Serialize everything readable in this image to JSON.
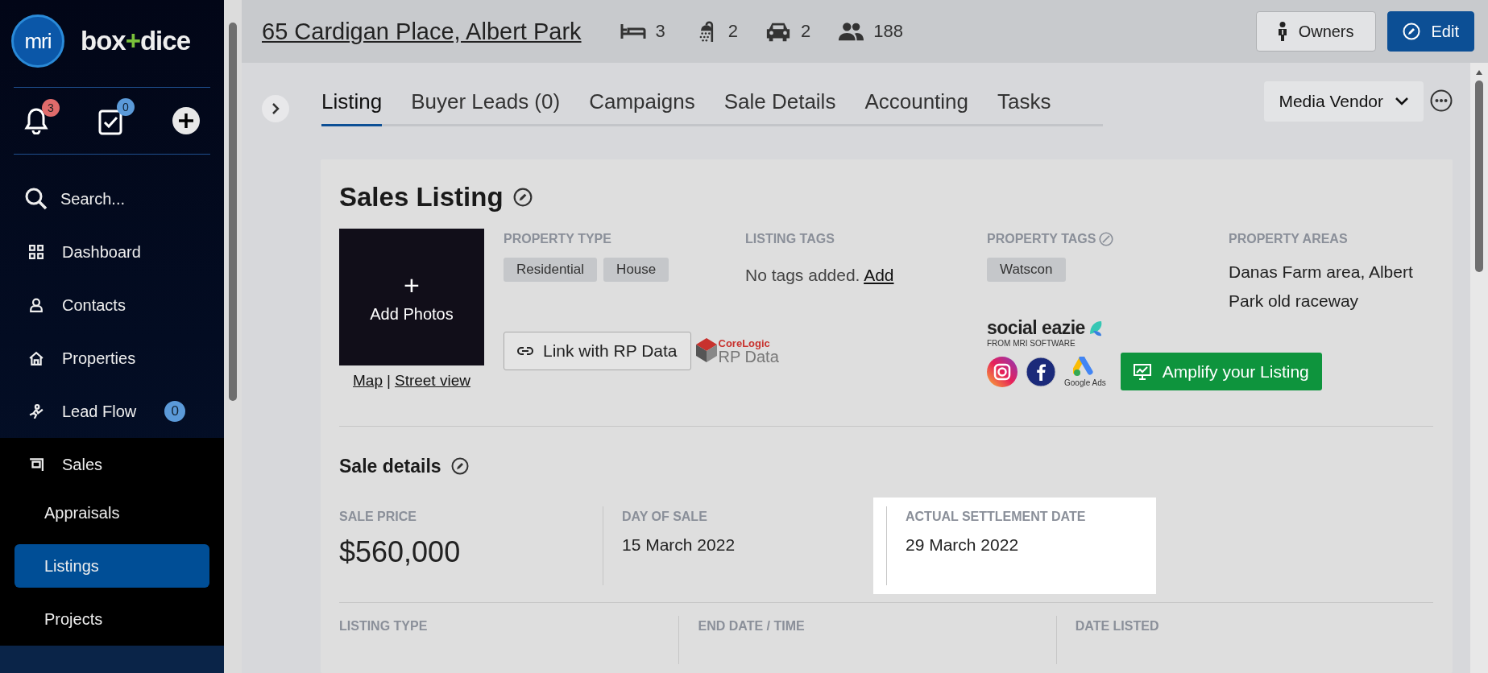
{
  "sidebar": {
    "logo": "mri",
    "brand": {
      "left": "box",
      "joiner": "+",
      "right": "dice"
    },
    "notifications": {
      "badge": "3"
    },
    "tasks": {
      "badge": "0"
    },
    "nav": [
      {
        "label": "Search...",
        "selected": false
      },
      {
        "label": "Dashboard",
        "selected": false
      },
      {
        "label": "Contacts",
        "selected": false
      },
      {
        "label": "Properties",
        "selected": false
      },
      {
        "label": "Lead Flow",
        "badge": "0",
        "selected": false
      },
      {
        "label": "Sales",
        "selected": false,
        "expanded": true,
        "children": [
          {
            "label": "Appraisals",
            "selected": false
          },
          {
            "label": "Listings",
            "selected": true
          },
          {
            "label": "Projects",
            "selected": false
          }
        ]
      }
    ]
  },
  "header": {
    "address": "65 Cardigan Place, Albert Park",
    "stats": [
      "3",
      "2",
      "2",
      "188"
    ],
    "buttons": [
      "Owners",
      "Edit"
    ]
  },
  "tabs": [
    {
      "label": "Listing",
      "selected": true
    },
    {
      "label": "Buyer Leads (0)",
      "selected": false
    },
    {
      "label": "Campaigns",
      "selected": false
    },
    {
      "label": "Sale Details",
      "selected": false
    },
    {
      "label": "Accounting",
      "selected": false
    },
    {
      "label": "Tasks",
      "selected": false
    }
  ],
  "role_dropdown": {
    "value": "Media Vendor"
  },
  "listing": {
    "title": "Sales Listing",
    "photo": {
      "plus": "+",
      "label": "Add Photos"
    },
    "map_links": [
      "Map",
      "Street view"
    ],
    "separator": "|",
    "property_type": {
      "label": "PROPERTY TYPE",
      "chips": [
        "Residential",
        "House"
      ]
    },
    "listing_tags": {
      "label": "LISTING TAGS",
      "empty": "No tags added.",
      "add": "Add"
    },
    "property_tags": {
      "label": "PROPERTY TAGS",
      "chips": [
        "Watscon"
      ]
    },
    "property_areas": {
      "label": "PROPERTY AREAS",
      "value": "Danas Farm area, Albert Park old raceway"
    },
    "rp_button": "Link with RP Data",
    "corelogic": {
      "brand": "CoreLogic",
      "product": "RP Data"
    },
    "social": {
      "brand": "social eazie",
      "tagline": "FROM MRI SOFTWARE",
      "ads_caption": "Google Ads",
      "amplify": "Amplify your Listing"
    }
  },
  "sale_details": {
    "title": "Sale details",
    "fields": [
      {
        "label": "SALE PRICE",
        "value": "$560,000",
        "highlighted": false
      },
      {
        "label": "DAY OF SALE",
        "value": "15 March 2022",
        "highlighted": false
      },
      {
        "label": "ACTUAL SETTLEMENT DATE",
        "value": "29 March 2022",
        "highlighted": true
      }
    ],
    "more_fields": [
      "LISTING TYPE",
      "END DATE / TIME",
      "DATE LISTED"
    ]
  }
}
